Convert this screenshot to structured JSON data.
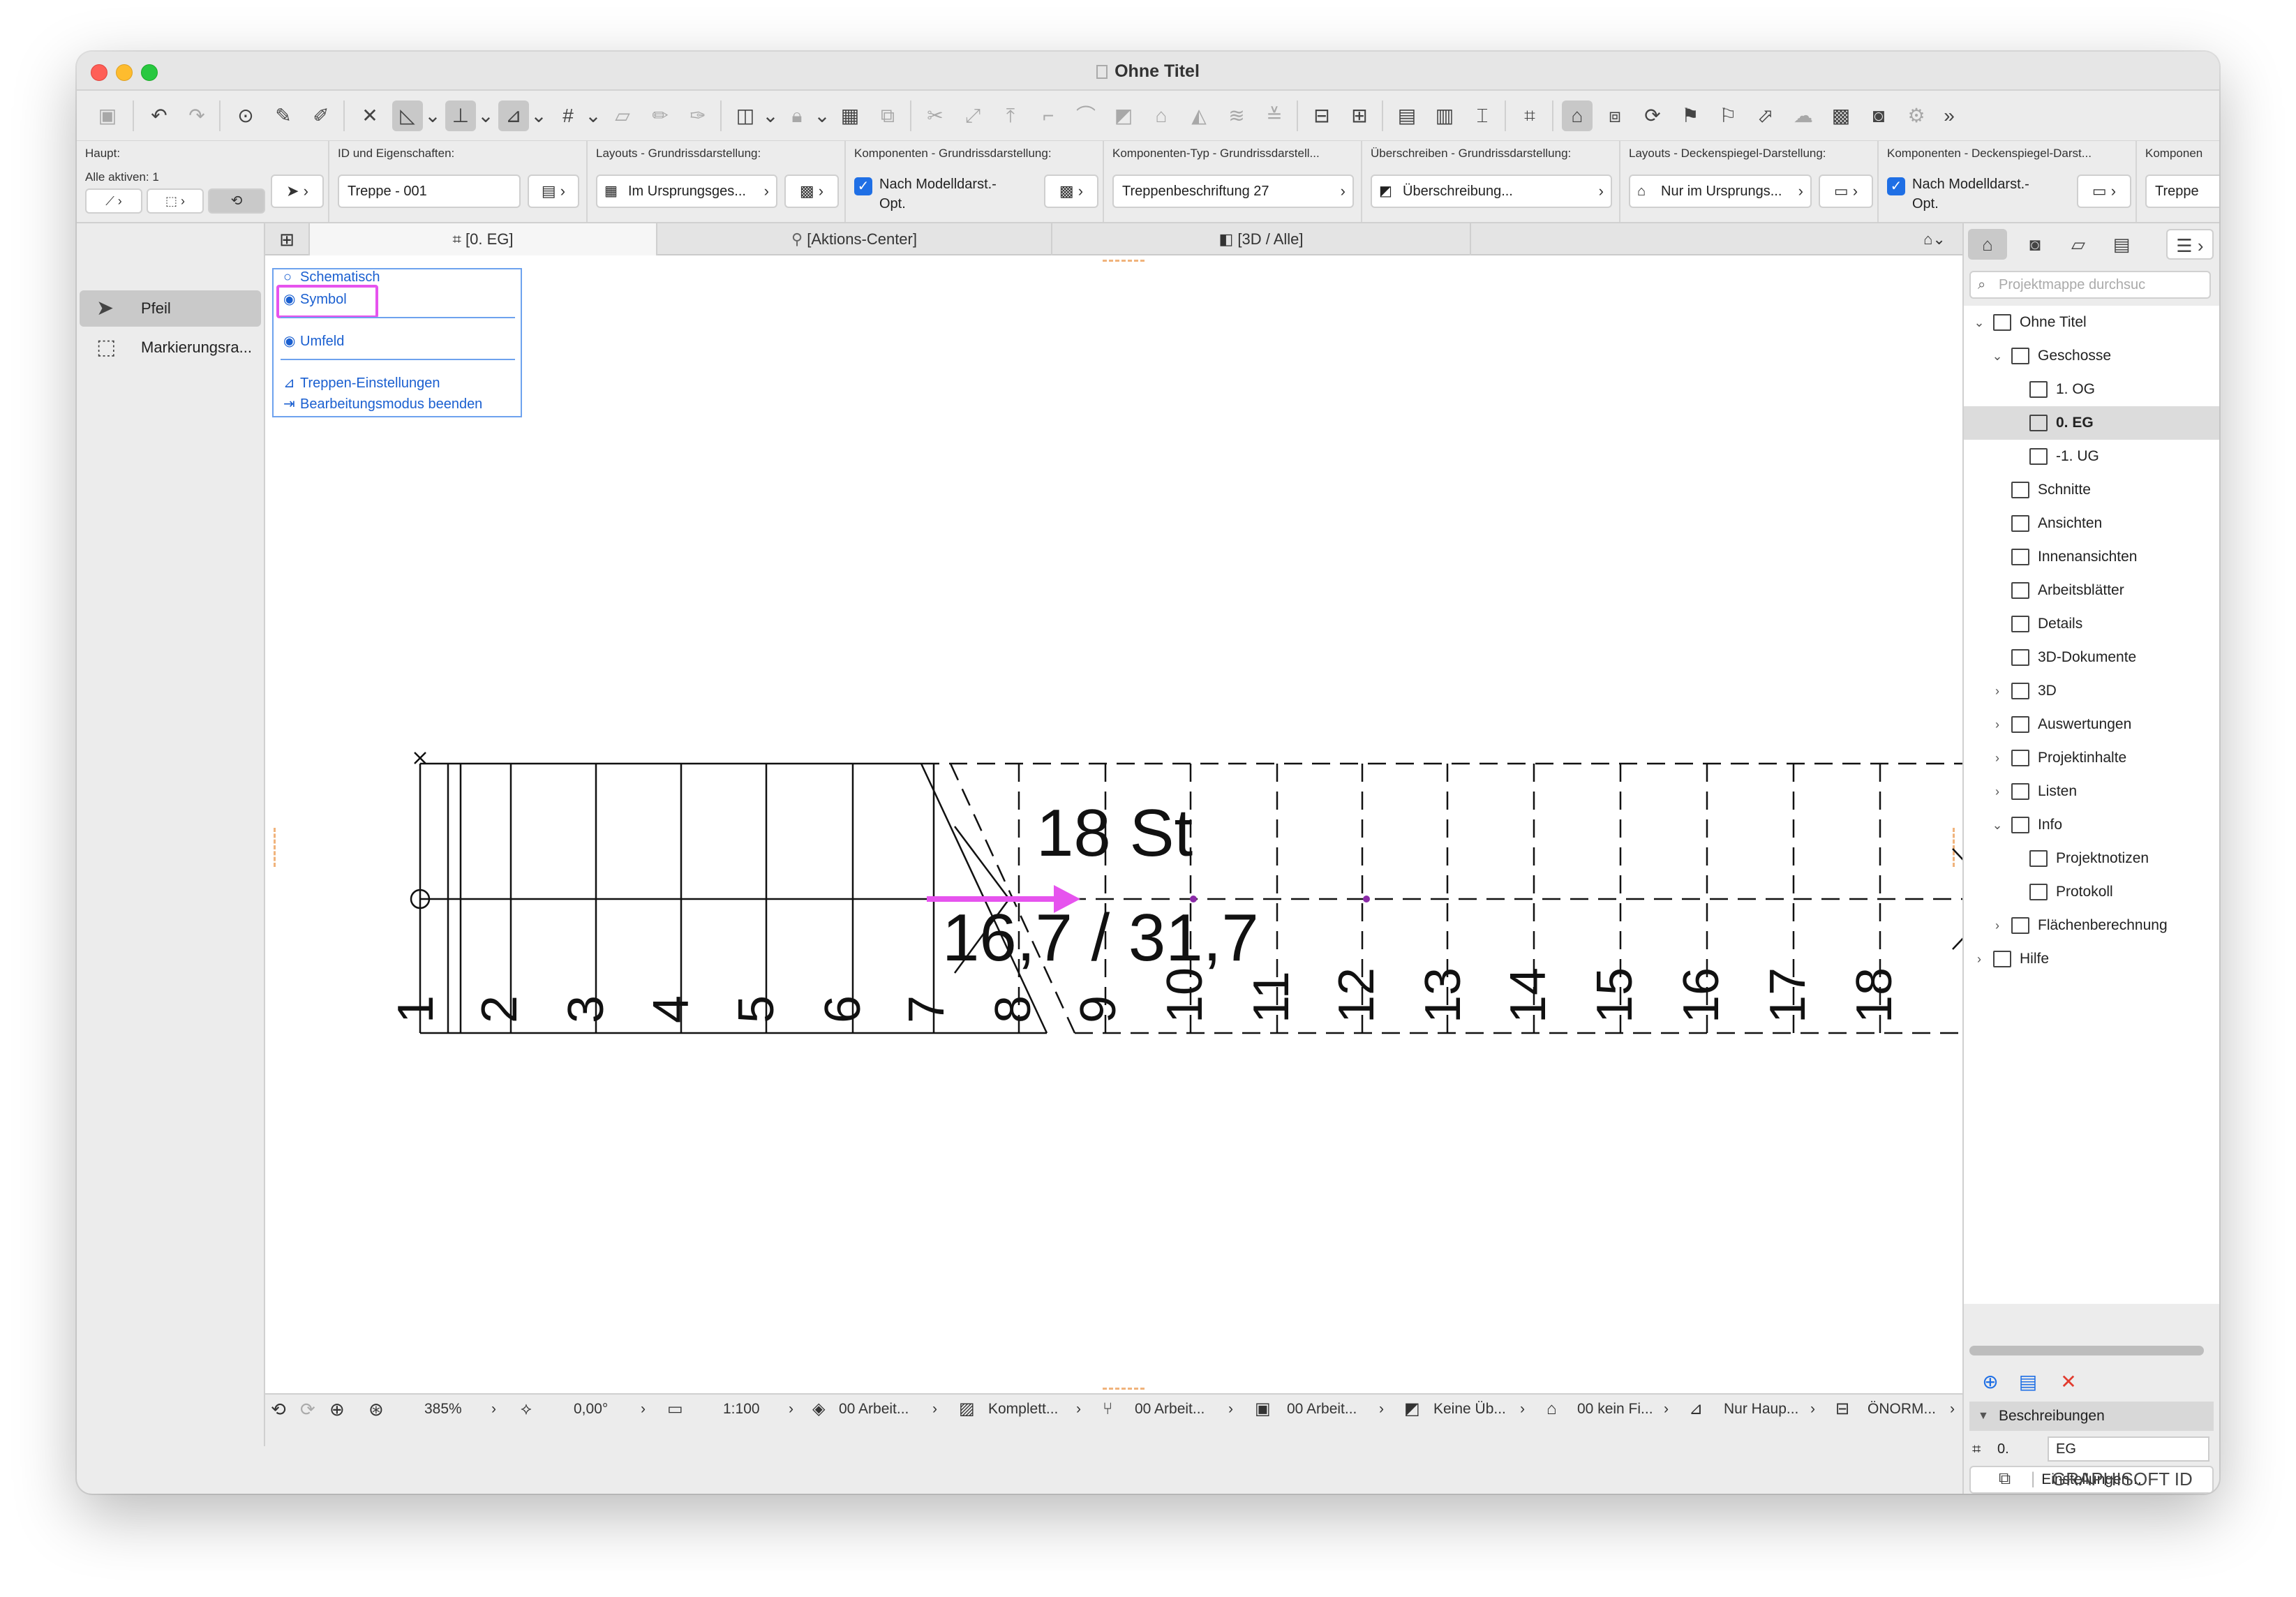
{
  "window": {
    "title": "Ohne Titel"
  },
  "infobox": {
    "haupt": {
      "label": "Haupt:",
      "sublabel": "Alle aktiven: 1"
    },
    "id": {
      "label": "ID und Eigenschaften:",
      "value": "Treppe - 001"
    },
    "layouts_grundriss": {
      "label": "Layouts - Grundrissdarstellung:",
      "value": "Im Ursprungsges..."
    },
    "komponenten_grundriss": {
      "label": "Komponenten - Grundrissdarstellung:",
      "line1": "Nach Modelldarst.-",
      "line2": "Opt."
    },
    "komponenten_typ": {
      "label": "Komponenten-Typ - Grundrissdarstell...",
      "value": "Treppenbeschriftung 27"
    },
    "ueberschreiben": {
      "label": "Überschreiben - Grundrissdarstellung:",
      "value": "Überschreibung..."
    },
    "layouts_decke": {
      "label": "Layouts - Deckenspiegel-Darstellung:",
      "value": "Nur im Ursprungs..."
    },
    "komponenten_decke": {
      "label": "Komponenten - Deckenspiegel-Darst...",
      "line1": "Nach Modelldarst.-",
      "line2": "Opt."
    },
    "komponen_cut": {
      "label": "Komponen",
      "value": "Treppe"
    }
  },
  "toolbox": {
    "items": [
      {
        "label": "Pfeil",
        "icon": "arrow-pointer-icon"
      },
      {
        "label": "Markierungsra...",
        "icon": "marquee-icon"
      }
    ]
  },
  "tabs": [
    {
      "label": "[0. EG]"
    },
    {
      "label": "[Aktions-Center]"
    },
    {
      "label": "[3D / Alle]"
    }
  ],
  "pet_palette": {
    "schematisch": "Schematisch",
    "symbol": "Symbol",
    "umfeld": "Umfeld",
    "einstellungen": "Treppen-Einstellungen",
    "beenden": "Bearbeitungsmodus beenden"
  },
  "stair": {
    "label_count": "18 St",
    "label_ratio": "16,7 / 31,7",
    "steps": [
      "1",
      "2",
      "3",
      "4",
      "5",
      "6",
      "7",
      "8",
      "9",
      "10",
      "11",
      "12",
      "13",
      "14",
      "15",
      "16",
      "17",
      "18"
    ]
  },
  "statusbar": {
    "zoom": "385%",
    "angle": "0,00°",
    "scale": "1:100",
    "layer_combo": "00 Arbeit...",
    "struct": "Komplett...",
    "pen_set": "00 Arbeit...",
    "model_view": "00 Arbeit...",
    "override": "Keine Üb...",
    "renovation": "00 kein Fi...",
    "dimension": "Nur Haup...",
    "norm": "ÖNORM..."
  },
  "navigator": {
    "search_placeholder": "Projektmappe durchsuc",
    "tree": [
      {
        "label": "Ohne Titel"
      },
      {
        "label": "Geschosse"
      },
      {
        "label": "1. OG"
      },
      {
        "label": "0. EG"
      },
      {
        "label": "-1. UG"
      },
      {
        "label": "Schnitte"
      },
      {
        "label": "Ansichten"
      },
      {
        "label": "Innenansichten"
      },
      {
        "label": "Arbeitsblätter"
      },
      {
        "label": "Details"
      },
      {
        "label": "3D-Dokumente"
      },
      {
        "label": "3D"
      },
      {
        "label": "Auswertungen"
      },
      {
        "label": "Projektinhalte"
      },
      {
        "label": "Listen"
      },
      {
        "label": "Info"
      },
      {
        "label": "Projektnotizen"
      },
      {
        "label": "Protokoll"
      },
      {
        "label": "Flächenberechnung"
      },
      {
        "label": "Hilfe"
      }
    ],
    "beschreibungen": "Beschreibungen",
    "id_value": "0.",
    "id_name": "EG",
    "einstellungen": "Einstellungen...",
    "graphisoft": "GRAPHISOFT ID"
  },
  "colors": {
    "accent": "#1f6fe5",
    "highlight": "#e653ee",
    "link": "#1a5fd0"
  }
}
